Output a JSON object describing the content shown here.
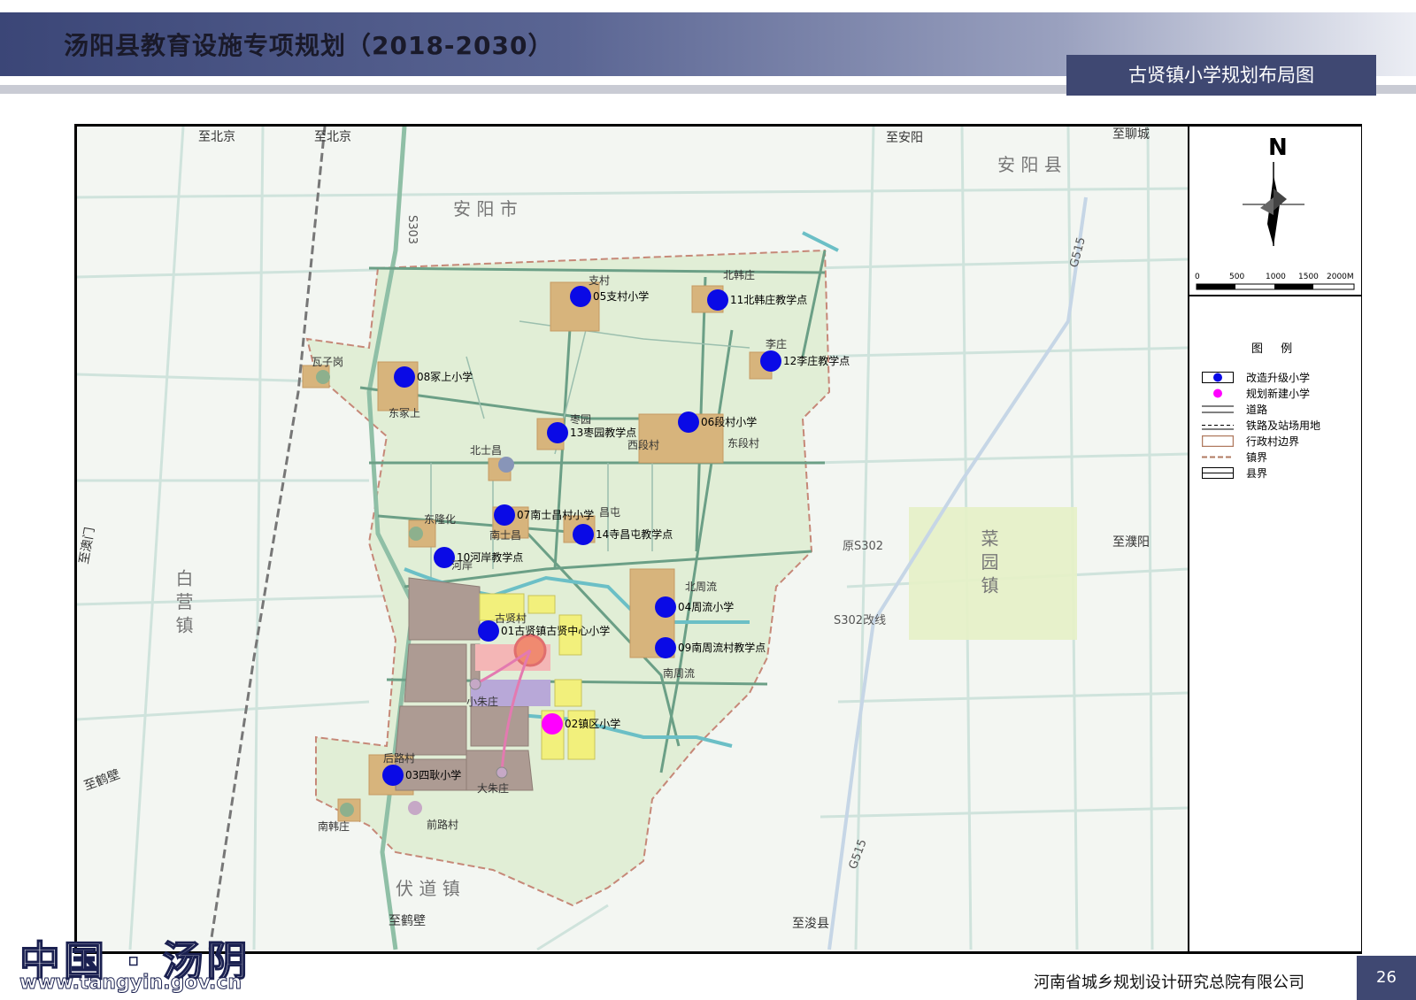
{
  "header": {
    "title": "汤阳县教育设施专项规划（2018-2030）",
    "sheet_title": "古贤镇小学规划布局图"
  },
  "footer": {
    "org": "河南省城乡规划设计研究总院有限公司",
    "page": "26"
  },
  "watermark": {
    "text": "中国 · 汤阴",
    "url": "www.tangyin.gov.cn"
  },
  "compass": {
    "north": "N"
  },
  "scale": {
    "ticks": [
      "0",
      "500",
      "1000",
      "1500",
      "2000M"
    ]
  },
  "legend": {
    "title": "图 例",
    "items": [
      {
        "label": "改造升级小学",
        "symbol": "blue-dot-icon"
      },
      {
        "label": "规划新建小学",
        "symbol": "magenta-dot-icon"
      },
      {
        "label": "道路",
        "symbol": "road-line-icon"
      },
      {
        "label": "铁路及站场用地",
        "symbol": "railway-line-icon"
      },
      {
        "label": "行政村边界",
        "symbol": "village-boundary-icon"
      },
      {
        "label": "镇界",
        "symbol": "town-boundary-icon"
      },
      {
        "label": "县界",
        "symbol": "county-boundary-icon"
      }
    ]
  },
  "colors": {
    "upgrade_school": "#0a0ae6",
    "new_school": "#ff00ff",
    "town_area": "#e0ecd2",
    "village": "#d7b47c",
    "residential": "#ad9b93",
    "commercial": "#f2f07c",
    "header": "#3f4872"
  },
  "schools": [
    {
      "id": "01",
      "label": "01古贤镇古贤中心小学",
      "type": "upgrade"
    },
    {
      "id": "02",
      "label": "02镇区小学",
      "type": "new"
    },
    {
      "id": "03",
      "label": "03四耿小学",
      "type": "upgrade"
    },
    {
      "id": "04",
      "label": "04周流小学",
      "type": "upgrade"
    },
    {
      "id": "05",
      "label": "05支村小学",
      "type": "upgrade"
    },
    {
      "id": "06",
      "label": "06段村小学",
      "type": "upgrade"
    },
    {
      "id": "07",
      "label": "07南士昌村小学",
      "type": "upgrade"
    },
    {
      "id": "08",
      "label": "08冢上小学",
      "type": "upgrade"
    },
    {
      "id": "09",
      "label": "09南周流村教学点",
      "type": "upgrade"
    },
    {
      "id": "10",
      "label": "10河岸教学点",
      "type": "upgrade"
    },
    {
      "id": "11",
      "label": "11北韩庄教学点",
      "type": "upgrade"
    },
    {
      "id": "12",
      "label": "12李庄教学点",
      "type": "upgrade"
    },
    {
      "id": "13",
      "label": "13枣园教学点",
      "type": "upgrade"
    },
    {
      "id": "14",
      "label": "14寺昌屯教学点",
      "type": "upgrade"
    }
  ],
  "places": {
    "zhicun": "支村",
    "beihanzhuang": "北韩庄",
    "lizhuang": "李庄",
    "waziang": "瓦子岗",
    "dongzhongshang": "东冢上",
    "zaoyuan": "枣园",
    "xiduancun": "西段村",
    "dongduancun": "东段村",
    "beishichang": "北士昌",
    "nanshichang": "南士昌",
    "donglonghua": "东隆化",
    "hean": "河岸",
    "changtun": "昌屯",
    "beizhouliu": "北周流",
    "nanzhouliu": "南周流",
    "guxiancun": "古贤村",
    "xiaozhuzhuang": "小朱庄",
    "dazhuzhuang": "大朱庄",
    "houlucun": "后路村",
    "qianlucun": "前路村",
    "nanhanzhuang": "南韩庄"
  },
  "directions": {
    "beijing1": "至北京",
    "beijing2": "至北京",
    "anyang": "至安阳",
    "liaocheng": "至聊城",
    "puyang": "至濮阳",
    "hebi1": "至鹤壁",
    "hebi2": "至鹤壁",
    "junxian": "至浚县",
    "aomen": "至澳门"
  },
  "regions": {
    "anyang_shi": "安 阳 市",
    "anyang_xian": "安 阳 县",
    "baiying_zhen": "白 营 镇",
    "caiyuan_zhen": "菜 园 镇",
    "fudao_zhen": "伏 道 镇"
  },
  "roads": {
    "s302": "原S302",
    "s302new": "S302改线",
    "s303": "S303",
    "g515": "G515",
    "g515b": "G515"
  }
}
